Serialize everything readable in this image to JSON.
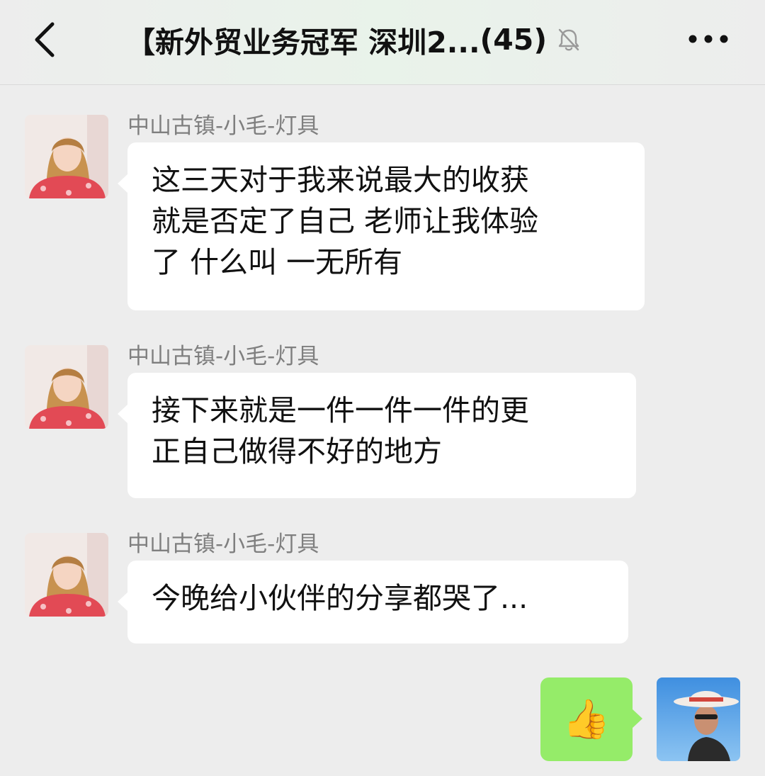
{
  "header": {
    "title": "【新外贸业务冠军 深圳2...",
    "member_count": "(45)",
    "icons": {
      "back": "chevron-left-icon",
      "mute": "bell-muted-icon",
      "more": "more-dots-icon"
    }
  },
  "messages": [
    {
      "sender": "中山古镇-小毛-灯具",
      "lines": [
        "这三天对于我来说最大的收获",
        "就是否定了自己 老师让我体验",
        "了 什么叫  一无所有"
      ]
    },
    {
      "sender": "中山古镇-小毛-灯具",
      "lines": [
        "接下来就是一件一件一件的更",
        "正自己做得不好的地方"
      ]
    },
    {
      "sender": "中山古镇-小毛-灯具",
      "lines": [
        "今晚给小伙伴的分享都哭了..."
      ]
    }
  ],
  "sent_message": {
    "emoji": "👍"
  },
  "colors": {
    "background": "#ededed",
    "sent_bubble": "#95ec69",
    "received_bubble": "#ffffff",
    "sender_name": "#7f7f7f"
  }
}
